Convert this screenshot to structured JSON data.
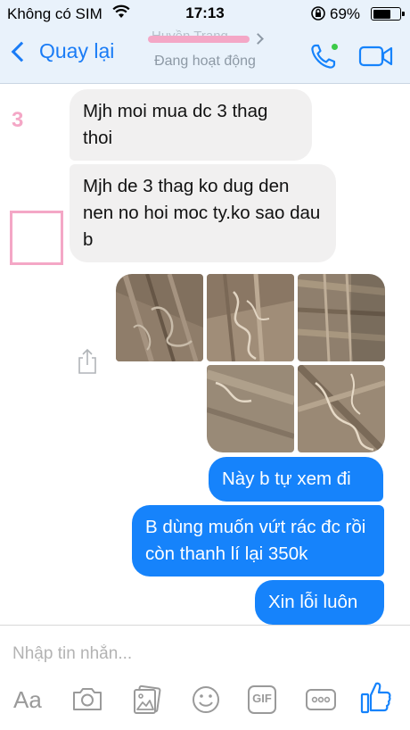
{
  "status_bar": {
    "carrier": "Không có SIM",
    "time": "17:13",
    "battery": "69%",
    "battery_level": 0.69
  },
  "header": {
    "back_label": "Quay lại",
    "contact_name": "Huyền Trang",
    "status": "Đang hoạt động"
  },
  "sidebar_marks": {
    "number": "3"
  },
  "messages": [
    {
      "direction": "incoming",
      "text": "Mjh moi mua dc 3 thag thoi"
    },
    {
      "direction": "incoming",
      "text": "Mjh de 3 thag ko dug den nen no hoi moc ty.ko sao dau b"
    },
    {
      "direction": "incoming",
      "type": "photos",
      "count": 5
    },
    {
      "direction": "outgoing",
      "text": "Này b tự xem đi"
    },
    {
      "direction": "outgoing",
      "text": "B dùng muốn vứt rác đc rồi còn thanh lí lại 350k"
    },
    {
      "direction": "outgoing",
      "text": "Xin lỗi luôn"
    }
  ],
  "composer": {
    "placeholder": "Nhập tin nhắn...",
    "aa_label": "Aa",
    "gif_label": "GIF"
  },
  "colors": {
    "accent": "#1683fb",
    "incoming_bubble": "#f1f0f0",
    "header_bg": "#e9f2fb",
    "highlight_pink": "#f4a7c6",
    "online": "#3ccb48"
  },
  "icons": [
    "wifi-icon",
    "lock-rotation-icon",
    "battery-icon",
    "phone-icon",
    "video-camera-icon",
    "share-icon",
    "camera-icon",
    "gallery-icon",
    "emoji-icon",
    "gif-icon",
    "more-icon",
    "thumbs-up-icon"
  ]
}
